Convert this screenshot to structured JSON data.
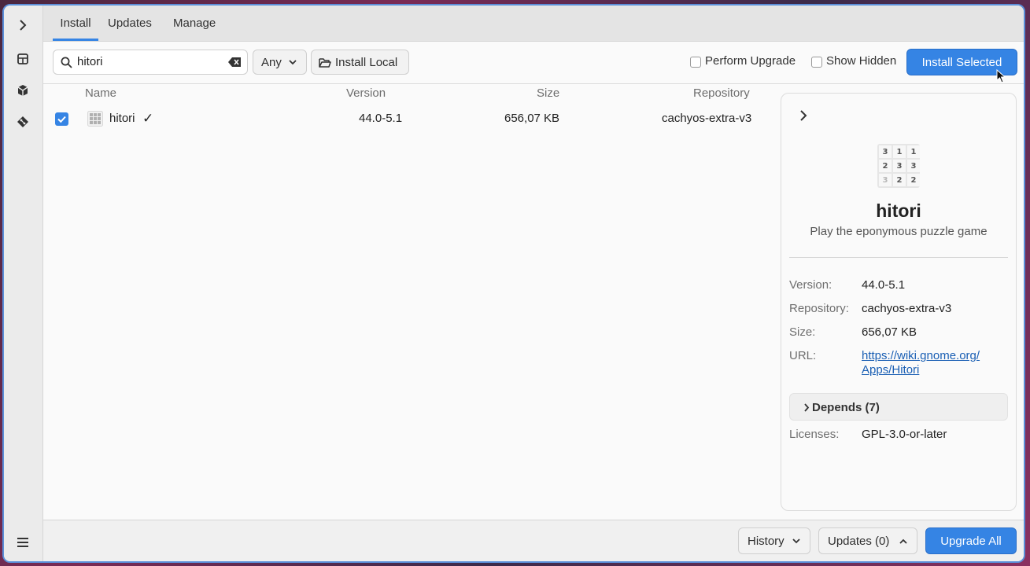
{
  "tabs": [
    {
      "label": "Install"
    },
    {
      "label": "Updates"
    },
    {
      "label": "Manage"
    }
  ],
  "search": {
    "value": "hitori"
  },
  "filter": {
    "selected": "Any"
  },
  "toolbar": {
    "install_local": "Install Local",
    "perform_upgrade": "Perform Upgrade",
    "show_hidden": "Show Hidden",
    "install_selected": "Install Selected"
  },
  "table": {
    "headers": [
      "Name",
      "Version",
      "Size",
      "Repository"
    ],
    "rows": [
      {
        "name": "hitori",
        "status_mark": "✓",
        "version": "44.0-5.1",
        "size": "656,07 KB",
        "repository": "cachyos-extra-v3",
        "selected": true
      }
    ]
  },
  "detail": {
    "name": "hitori",
    "summary": "Play the eponymous puzzle game",
    "icon_grid": [
      "3",
      "1",
      "1",
      "2",
      "3",
      "3",
      "3",
      "2",
      "2"
    ],
    "fields": [
      {
        "key": "Version:",
        "value": "44.0-5.1"
      },
      {
        "key": "Repository:",
        "value": "cachyos-extra-v3"
      },
      {
        "key": "Size:",
        "value": "656,07 KB"
      }
    ],
    "url_label": "URL:",
    "url_line1": "https://wiki.gnome.org/",
    "url_line2": "Apps/Hitori",
    "depends": "Depends (7)",
    "licenses_label": "Licenses:",
    "licenses_value": "GPL-3.0-or-later"
  },
  "bottom": {
    "history": "History",
    "updates": "Updates (0)",
    "upgrade_all": "Upgrade All"
  },
  "colors": {
    "accent": "#3584e4",
    "link": "#1a5fb4"
  }
}
